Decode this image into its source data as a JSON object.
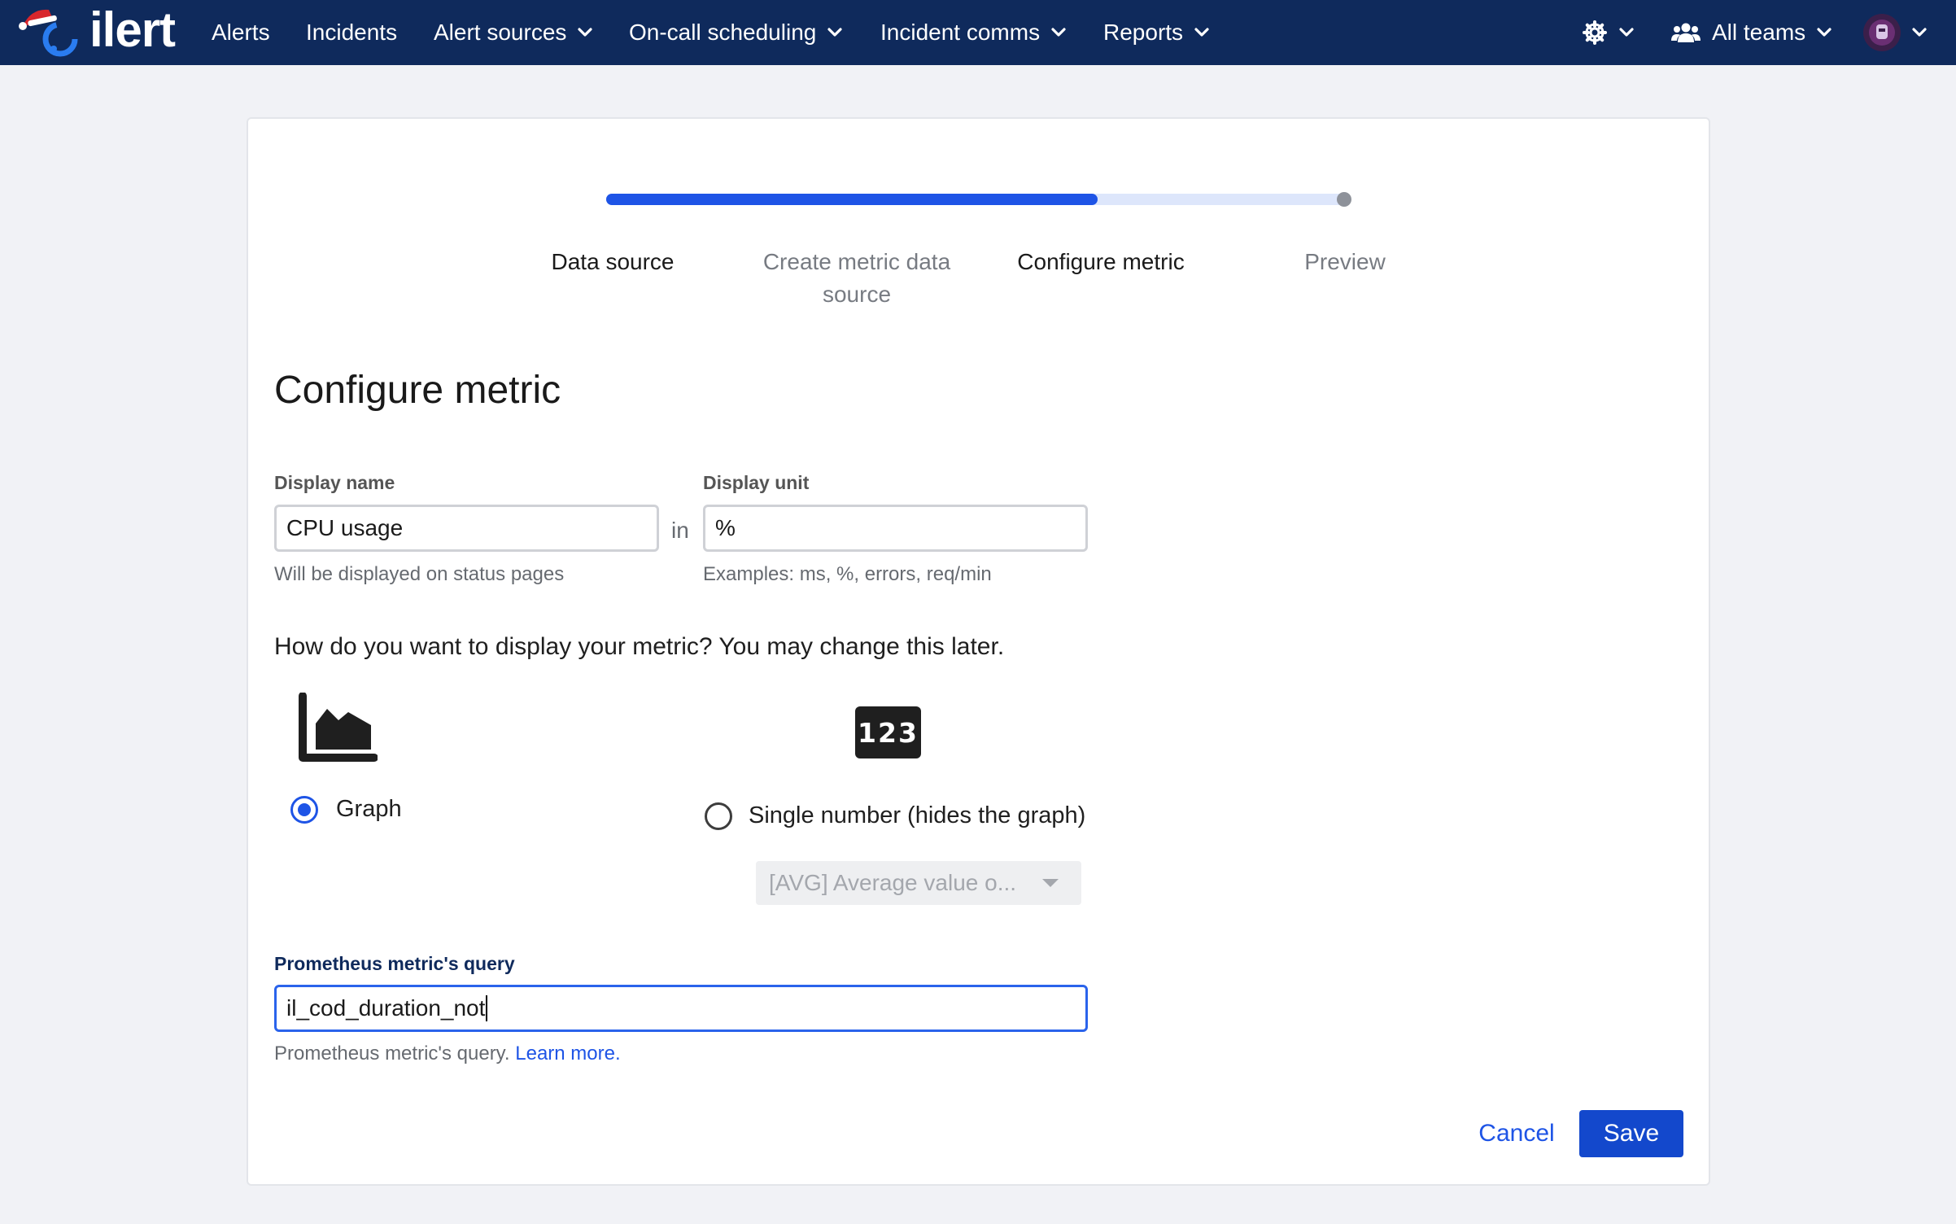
{
  "nav": {
    "logo_text": "ilert",
    "items": [
      {
        "label": "Alerts"
      },
      {
        "label": "Incidents"
      },
      {
        "label": "Alert sources"
      },
      {
        "label": "On-call scheduling"
      },
      {
        "label": "Incident comms"
      },
      {
        "label": "Reports"
      }
    ],
    "teams_label": "All teams"
  },
  "stepper": {
    "steps": [
      {
        "label": "Data source",
        "state": "done"
      },
      {
        "label": "Create metric data source",
        "state": "pending"
      },
      {
        "label": "Configure metric",
        "state": "active"
      },
      {
        "label": "Preview",
        "state": "pending"
      }
    ],
    "progress_fraction": 0.66
  },
  "form": {
    "title": "Configure metric",
    "display_name": {
      "label": "Display name",
      "value": "CPU usage",
      "help": "Will be displayed on status pages"
    },
    "in_word": "in",
    "display_unit": {
      "label": "Display unit",
      "value": "%",
      "help": "Examples: ms, %, errors, req/min"
    },
    "display_question": "How do you want to display your metric? You may change this later.",
    "options": {
      "graph_label": "Graph",
      "graph_selected": true,
      "single_label": "Single number (hides the graph)",
      "single_selected": false,
      "single_icon_text": "123",
      "aggregation_value": "[AVG] Average value o..."
    },
    "query": {
      "label": "Prometheus metric's query",
      "value": "il_cod_duration_not",
      "help": "Prometheus metric's query.",
      "help_link": "Learn more."
    }
  },
  "actions": {
    "cancel": "Cancel",
    "save": "Save"
  },
  "colors": {
    "nav_bg": "#0f2a5c",
    "accent": "#1e54e6",
    "save_bg": "#1348cc"
  }
}
